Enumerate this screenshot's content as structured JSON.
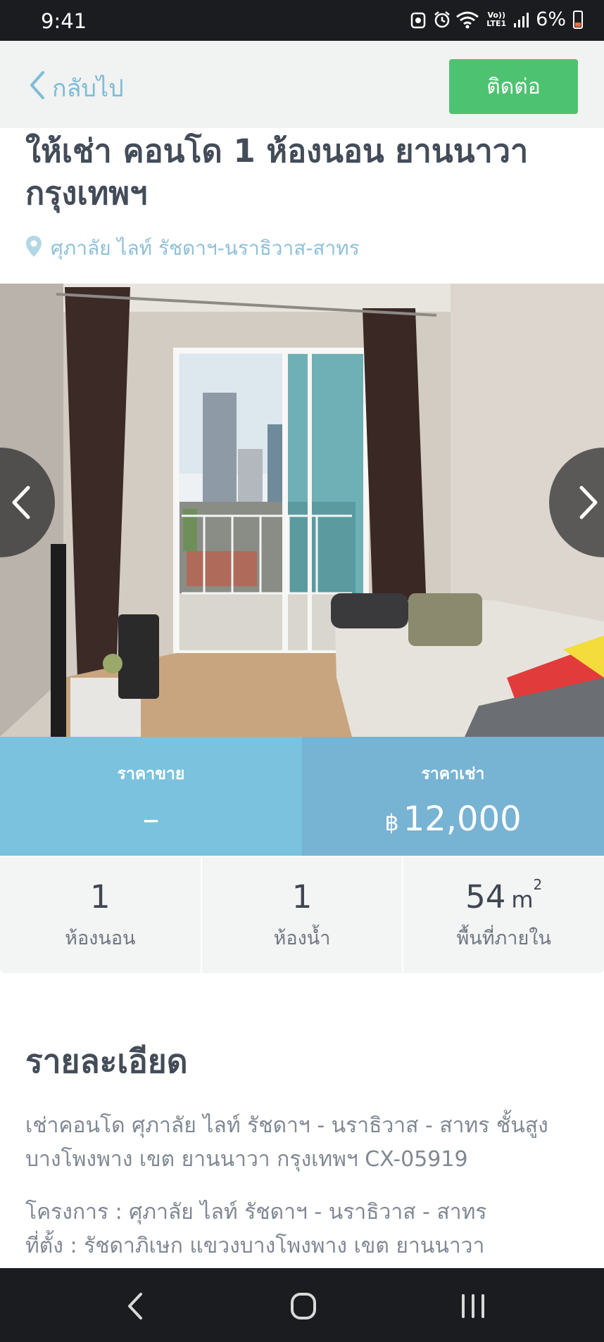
{
  "status_bar": {
    "time": "9:41",
    "battery": "6%",
    "volte_top": "Vo))",
    "volte_bottom": "LTE1"
  },
  "header": {
    "back_label": "กลับไป",
    "contact_label": "ติดต่อ"
  },
  "listing": {
    "title": "ให้เช่า คอนโด 1 ห้องนอน ยานนาวา กรุงเทพฯ",
    "location": "ศุภาลัย ไลท์ รัชดาฯ-นราธิวาส-สาทร"
  },
  "prices": {
    "sale_label": "ราคาขาย",
    "sale_value": "–",
    "rent_label": "ราคาเช่า",
    "currency": "฿",
    "rent_value": "12,000"
  },
  "stats": {
    "bedrooms": "1",
    "bedrooms_label": "ห้องนอน",
    "bathrooms": "1",
    "bathrooms_label": "ห้องน้ำ",
    "area": "54",
    "area_unit": "m",
    "area_unit_sup": "2",
    "area_label": "พื้นที่ภายใน"
  },
  "details": {
    "heading": "รายละเอียด",
    "paragraph_1": "เช่าคอนโด ศุภาลัย ไลท์ รัชดาฯ - นราธิวาส - สาทร ชั้นสูง บางโพงพาง เขต ยานนาวา กรุงเทพฯ CX-05919",
    "project_line": "โครงการ : ศุภาลัย ไลท์ รัชดาฯ - นราธิวาส - สาทร",
    "address_line": "ที่ตั้ง : รัชดาภิเษก แขวงบางโพงพาง เขต ยานนาวา"
  },
  "colors": {
    "accent_green": "#4dc371",
    "price_sale_bg": "#7bc2de",
    "price_rent_bg": "#77b3d3",
    "link_blue": "#7fbcd6"
  }
}
